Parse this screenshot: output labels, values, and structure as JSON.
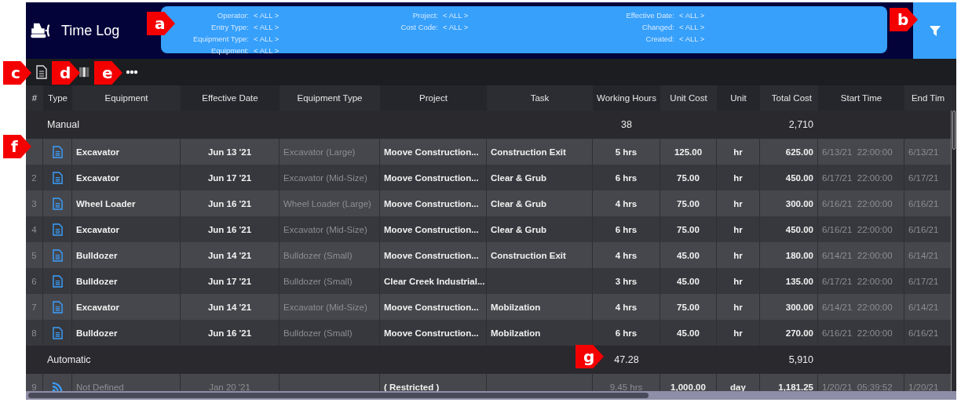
{
  "window": {
    "title": "Time Log"
  },
  "filter_columns": [
    {
      "items": [
        {
          "label": "Operator:",
          "value": "< ALL >"
        },
        {
          "label": "Entry Type:",
          "value": "< ALL >"
        },
        {
          "label": "Equipment Type:",
          "value": "< ALL >"
        },
        {
          "label": "Equipment:",
          "value": "< ALL >"
        }
      ]
    },
    {
      "items": [
        {
          "label": "Project:",
          "value": "< ALL >"
        },
        {
          "label": "Cost Code:",
          "value": "< ALL >"
        }
      ]
    },
    {
      "items": [
        {
          "label": "Effective Date:",
          "value": "< ALL >"
        },
        {
          "label": "Changed:",
          "value": "< ALL >"
        },
        {
          "label": "Created:",
          "value": "< ALL >"
        }
      ]
    }
  ],
  "table": {
    "columns": [
      "#",
      "Type",
      "Equipment",
      "Effective Date",
      "Equipment Type",
      "Project",
      "Task",
      "Working Hours",
      "Unit Cost",
      "Unit",
      "Total Cost",
      "Start Time",
      "End Tim"
    ],
    "groups": [
      {
        "name": "Manual",
        "working_hours_total": "38",
        "total_cost_total": "2,710",
        "rows": [
          {
            "kind": "document",
            "equipment": "Excavator",
            "effective_date": "Jun 13 '21",
            "equipment_type": "Excavator (Large)",
            "project": "Moove Construction...",
            "task": "Construction Exit",
            "working_hours": "5 hrs",
            "unit_cost": "125.00",
            "unit": "hr",
            "total_cost": "625.00",
            "start_time": "6/13/21  22:00:00",
            "end_time": "6/13/21"
          },
          {
            "number": "2",
            "kind": "document",
            "equipment": "Excavator",
            "effective_date": "Jun 17 '21",
            "equipment_type": "Excavator (Mid-Size)",
            "project": "Moove Construction...",
            "task": "Clear & Grub",
            "working_hours": "6 hrs",
            "unit_cost": "75.00",
            "unit": "hr",
            "total_cost": "450.00",
            "start_time": "6/17/21  22:00:00",
            "end_time": "6/17/21"
          },
          {
            "number": "3",
            "kind": "document",
            "equipment": "Wheel Loader",
            "effective_date": "Jun 16 '21",
            "equipment_type": "Wheel Loader (Large)",
            "project": "Moove Construction...",
            "task": "Clear & Grub",
            "working_hours": "4 hrs",
            "unit_cost": "75.00",
            "unit": "hr",
            "total_cost": "300.00",
            "start_time": "6/16/21  22:00:00",
            "end_time": "6/16/21"
          },
          {
            "number": "4",
            "kind": "document",
            "equipment": "Excavator",
            "effective_date": "Jun 16 '21",
            "equipment_type": "Excavator (Mid-Size)",
            "project": "Moove Construction...",
            "task": "Clear & Grub",
            "working_hours": "6 hrs",
            "unit_cost": "75.00",
            "unit": "hr",
            "total_cost": "450.00",
            "start_time": "6/16/21  22:00:00",
            "end_time": "6/16/21"
          },
          {
            "number": "5",
            "kind": "document",
            "equipment": "Bulldozer",
            "effective_date": "Jun 14 '21",
            "equipment_type": "Bulldozer (Small)",
            "project": "Moove Construction...",
            "task": "Construction Exit",
            "working_hours": "4 hrs",
            "unit_cost": "45.00",
            "unit": "hr",
            "total_cost": "180.00",
            "start_time": "6/14/21  22:00:00",
            "end_time": "6/14/21"
          },
          {
            "number": "6",
            "kind": "document",
            "equipment": "Bulldozer",
            "effective_date": "Jun 17 '21",
            "equipment_type": "Bulldozer (Small)",
            "project": "Clear Creek Industrial...",
            "working_hours": "3 hrs",
            "unit_cost": "45.00",
            "unit": "hr",
            "total_cost": "135.00",
            "start_time": "6/17/21  22:00:00",
            "end_time": "6/17/21"
          },
          {
            "number": "7",
            "kind": "document",
            "equipment": "Excavator",
            "effective_date": "Jun 14 '21",
            "equipment_type": "Excavator (Mid-Size)",
            "project": "Moove Construction...",
            "task": "Mobilzation",
            "working_hours": "4 hrs",
            "unit_cost": "75.00",
            "unit": "hr",
            "total_cost": "300.00",
            "start_time": "6/14/21  22:00:00",
            "end_time": "6/14/21"
          },
          {
            "number": "8",
            "kind": "document",
            "equipment": "Bulldozer",
            "effective_date": "Jun 16 '21",
            "equipment_type": "Bulldozer (Small)",
            "project": "Moove Construction...",
            "task": "Mobilzation",
            "working_hours": "6 hrs",
            "unit_cost": "45.00",
            "unit": "hr",
            "total_cost": "270.00",
            "start_time": "6/16/21  22:00:00",
            "end_time": "6/16/21"
          }
        ]
      },
      {
        "name": "Automatic",
        "working_hours_total": "47.28",
        "total_cost_total": "5,910",
        "rows": [
          {
            "number": "9",
            "kind": "feed",
            "equipment": "Not Defined",
            "effective_date": "Jan 20 '21",
            "project": "( Restricted )",
            "working_hours": "9.45 hrs",
            "unit_cost": "1,000.00",
            "unit": "day",
            "total_cost": "1,181.25",
            "start_time": "1/20/21  05:39:52",
            "end_time": "1/20/21"
          }
        ]
      }
    ]
  },
  "callouts": [
    {
      "label": "a"
    },
    {
      "label": "b"
    },
    {
      "label": "c"
    },
    {
      "label": "d"
    },
    {
      "label": "e"
    },
    {
      "label": "f"
    },
    {
      "label": "g"
    }
  ]
}
